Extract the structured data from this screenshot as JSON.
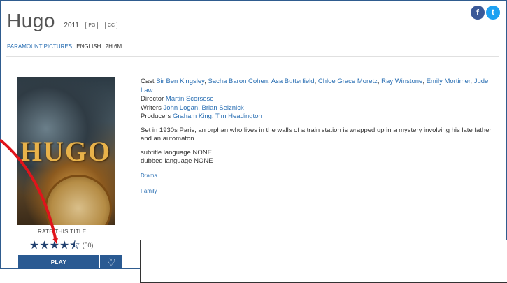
{
  "movie": {
    "title": "Hugo",
    "year": "2011",
    "rating_badge": "PG",
    "cc_badge": "CC",
    "studio": "PARAMOUNT PICTURES",
    "language": "ENGLISH",
    "duration": "2H 6M",
    "poster_title": "HUGO"
  },
  "social": {
    "facebook_glyph": "f",
    "twitter_glyph": "t"
  },
  "details": {
    "cast_label": "Cast",
    "cast": [
      "Sir Ben Kingsley",
      "Sacha Baron Cohen",
      "Asa Butterfield",
      "Chloe Grace Moretz",
      "Ray Winstone",
      "Emily Mortimer",
      "Jude Law"
    ],
    "director_label": "Director",
    "director": "Martin Scorsese",
    "writers_label": "Writers",
    "writers": [
      "John Logan",
      "Brian Selznick"
    ],
    "producers_label": "Producers",
    "producers": [
      "Graham King",
      "Tim Headington"
    ],
    "synopsis": "Set in 1930s Paris, an orphan who lives in the walls of a train station is wrapped up in a mystery involving his late father and an automaton.",
    "subtitle_language": "subtitle language NONE",
    "dubbed_language": "dubbed language NONE",
    "genres": [
      "Drama",
      "Family"
    ]
  },
  "rating": {
    "label": "RATE THIS TITLE",
    "stars_value": 4.5,
    "stars_max": 5,
    "count": "(50)"
  },
  "actions": {
    "play_label": "PLAY",
    "favorite_glyph": "♡"
  },
  "colors": {
    "frame_border": "#2f5c8f",
    "link": "#2a6fb3",
    "button_bg": "#2a5a92",
    "annotation_arrow": "#e0141b"
  }
}
